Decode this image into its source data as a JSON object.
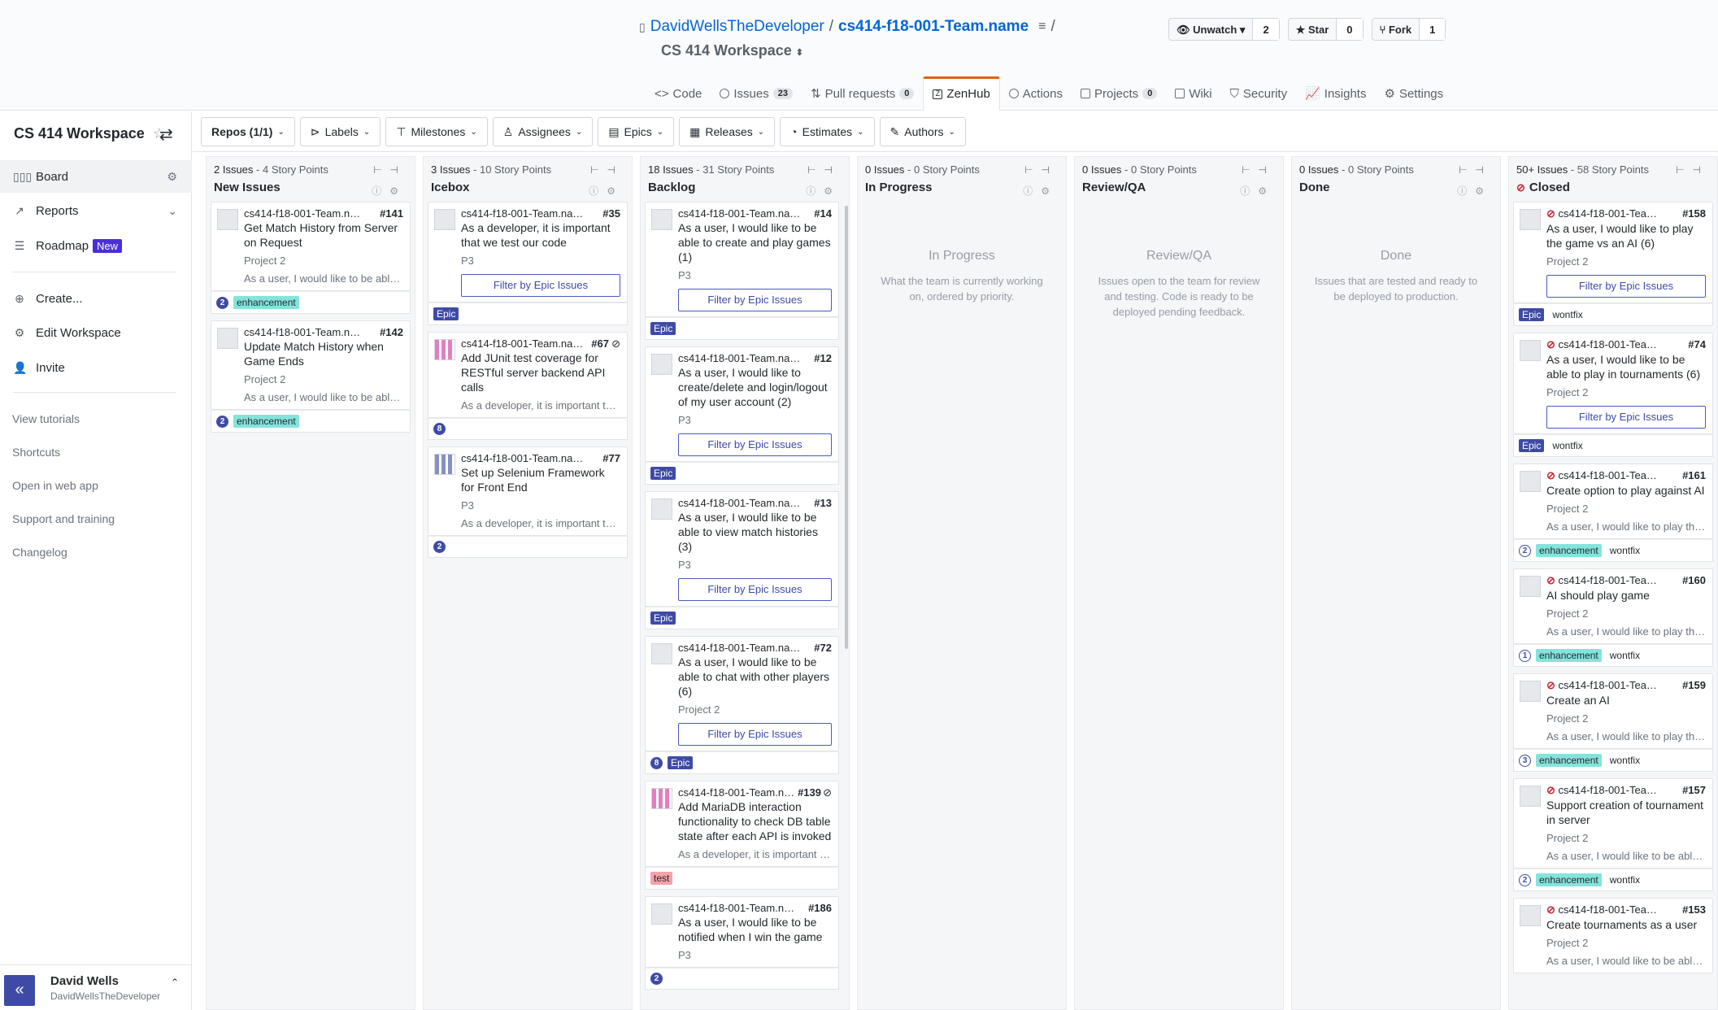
{
  "repo": {
    "owner": "DavidWellsTheDeveloper",
    "name": "cs414-f18-001-Team.name",
    "workspace": "CS 414 Workspace"
  },
  "gh_buttons": [
    {
      "label": "Unwatch",
      "count": "2"
    },
    {
      "label": "Star",
      "count": "0"
    },
    {
      "label": "Fork",
      "count": "1"
    }
  ],
  "tabs": [
    {
      "label": "Code"
    },
    {
      "label": "Issues",
      "count": "23"
    },
    {
      "label": "Pull requests",
      "count": "0"
    },
    {
      "label": "ZenHub"
    },
    {
      "label": "Actions"
    },
    {
      "label": "Projects",
      "count": "0"
    },
    {
      "label": "Wiki"
    },
    {
      "label": "Security"
    },
    {
      "label": "Insights"
    },
    {
      "label": "Settings"
    }
  ],
  "sidebar": {
    "title": "CS 414 Workspace",
    "items": [
      {
        "label": "Board",
        "icon": "board-icon"
      },
      {
        "label": "Reports",
        "icon": "reports-icon"
      },
      {
        "label": "Roadmap",
        "icon": "roadmap-icon",
        "badge": "New"
      },
      {
        "label": "Create...",
        "icon": "plus-icon"
      },
      {
        "label": "Edit Workspace",
        "icon": "gear-icon"
      },
      {
        "label": "Invite",
        "icon": "invite-icon"
      }
    ],
    "links": [
      "View tutorials",
      "Shortcuts",
      "Open in web app",
      "Support and training",
      "Changelog"
    ],
    "user": {
      "name": "David Wells",
      "handle": "DavidWellsTheDeveloper"
    }
  },
  "filters": [
    "Repos (1/1)",
    "Labels",
    "Milestones",
    "Assignees",
    "Epics",
    "Releases",
    "Estimates",
    "Authors"
  ],
  "columns": [
    {
      "count": "2 Issues",
      "points": " - 4 Story Points",
      "name": "New Issues"
    },
    {
      "count": "3 Issues",
      "points": " - 10 Story Points",
      "name": "Icebox"
    },
    {
      "count": "18 Issues",
      "points": " - 31 Story Points",
      "name": "Backlog"
    },
    {
      "count": "0 Issues",
      "points": " - 0 Story Points",
      "name": "In Progress",
      "empty_title": "In Progress",
      "empty_desc": "What the team is currently working on, ordered by priority."
    },
    {
      "count": "0 Issues",
      "points": " - 0 Story Points",
      "name": "Review/QA",
      "empty_title": "Review/QA",
      "empty_desc": "Issues open to the team for review and testing. Code is ready to be deployed pending feedback."
    },
    {
      "count": "0 Issues",
      "points": " - 0 Story Points",
      "name": "Done",
      "empty_title": "Done",
      "empty_desc": "Issues that are tested and ready to be deployed to production."
    },
    {
      "count": "50+ Issues",
      "points": " - 58 Story Points",
      "name": "Closed"
    }
  ],
  "epic_button": "Filter by Epic Issues",
  "labels": {
    "enhancement": "enhancement",
    "epic": "Epic",
    "test": "test",
    "wontfix": "wontfix"
  },
  "cards": {
    "c141": {
      "repo": "cs414-f18-001-Team.n…",
      "num": "#141",
      "title": "Get Match History from Server on Request",
      "meta": "Project 2",
      "desc": "As a user, I would like to be able…",
      "est": "2"
    },
    "c142": {
      "repo": "cs414-f18-001-Team.n…",
      "num": "#142",
      "title": "Update Match History when Game Ends",
      "meta": "Project 2",
      "desc": "As a user, I would like to be able…",
      "est": "2"
    },
    "c35": {
      "repo": "cs414-f18-001-Team.na…",
      "num": "#35",
      "title": "As a developer, it is important that we test our code",
      "meta": "P3"
    },
    "c67": {
      "repo": "cs414-f18-001-Team.na…",
      "num": "#67",
      "title": "Add JUnit test coverage for RESTful server backend API calls",
      "desc": "As a developer, it is important th…",
      "est": "8"
    },
    "c77": {
      "repo": "cs414-f18-001-Team.na…",
      "num": "#77",
      "title": "Set up Selenium Framework for Front End",
      "meta": "P3",
      "desc": "As a developer, it is important th…",
      "est": "2"
    },
    "c14": {
      "repo": "cs414-f18-001-Team.na…",
      "num": "#14",
      "title": "As a user, I would like to be able to create and play games (1)",
      "meta": "P3"
    },
    "c12": {
      "repo": "cs414-f18-001-Team.na…",
      "num": "#12",
      "title": "As a user, I would like to create/delete and login/logout of my user account (2)",
      "meta": "P3"
    },
    "c13": {
      "repo": "cs414-f18-001-Team.na…",
      "num": "#13",
      "title": "As a user, I would like to be able to view match histories (3)",
      "meta": "P3"
    },
    "c72": {
      "repo": "cs414-f18-001-Team.na…",
      "num": "#72",
      "title": "As a user, I would like to be able to chat with other players (6)",
      "meta": "Project 2",
      "est": "8"
    },
    "c139": {
      "repo": "cs414-f18-001-Team.n…",
      "num": "#139",
      "title": "Add MariaDB interaction functionality to check DB table state after each API is invoked",
      "desc": "As a developer, it is important th…"
    },
    "c186": {
      "repo": "cs414-f18-001-Team.n…",
      "num": "#186",
      "title": "As a user, I would like to be notified when I win the game",
      "meta": "P3",
      "est": "2"
    },
    "c158": {
      "repo": "cs414-f18-001-Tea…",
      "num": "#158",
      "title": "As a user, I would like to play the game vs an AI (6)",
      "meta": "Project 2"
    },
    "c74": {
      "repo": "cs414-f18-001-Tea…",
      "num": "#74",
      "title": "As a user, I would like to be able to play in tournaments (6)",
      "meta": "Project 2"
    },
    "c161": {
      "repo": "cs414-f18-001-Tea…",
      "num": "#161",
      "title": "Create option to play against AI",
      "meta": "Project 2",
      "desc": "As a user, I would like to play th…",
      "est": "2"
    },
    "c160": {
      "repo": "cs414-f18-001-Tea…",
      "num": "#160",
      "title": "AI should play game",
      "meta": "Project 2",
      "desc": "As a user, I would like to play th…",
      "est": "1"
    },
    "c159": {
      "repo": "cs414-f18-001-Tea…",
      "num": "#159",
      "title": "Create an AI",
      "meta": "Project 2",
      "desc": "As a user, I would like to play th…",
      "est": "3"
    },
    "c157": {
      "repo": "cs414-f18-001-Tea…",
      "num": "#157",
      "title": "Support creation of tournament in server",
      "meta": "Project 2",
      "desc": "As a user, I would like to be able…",
      "est": "2"
    },
    "c153": {
      "repo": "cs414-f18-001-Tea…",
      "num": "#153",
      "title": "Create tournaments as a user",
      "meta": "Project 2",
      "desc": "As a user, I would like to be able…"
    }
  }
}
